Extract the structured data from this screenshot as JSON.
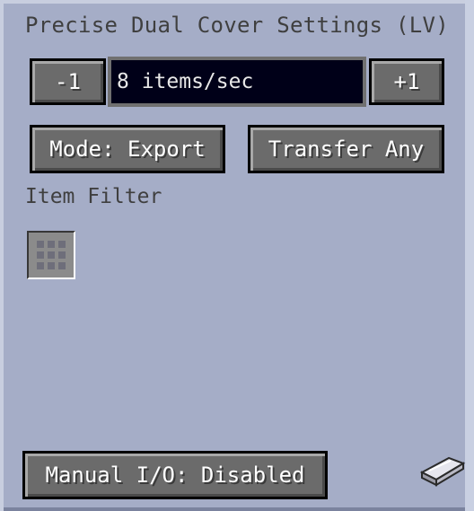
{
  "window": {
    "title": "Precise Dual Cover Settings (LV)"
  },
  "rate": {
    "decrement_label": "-1",
    "value": "8 items/sec",
    "increment_label": "+1"
  },
  "buttons": {
    "mode_label": "Mode: Export",
    "transfer_label": "Transfer Any",
    "manual_io_label": "Manual I/O: Disabled"
  },
  "filter": {
    "label": "Item Filter",
    "slot_icon": "grid-icon"
  },
  "decor": {
    "corner_icon": "ingot-icon"
  }
}
